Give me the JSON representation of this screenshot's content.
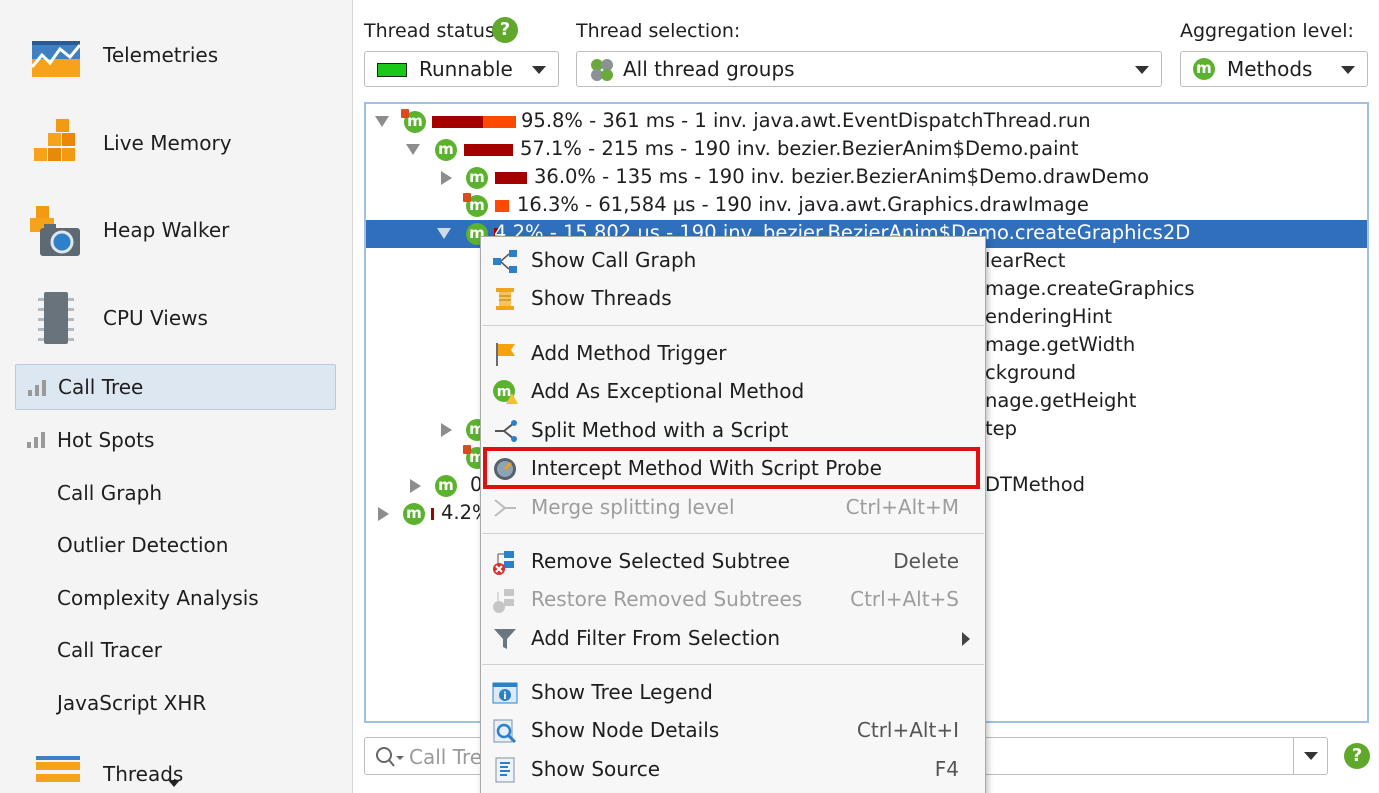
{
  "sidebar": {
    "big_items": [
      {
        "label": "Telemetries",
        "icon": "telemetries-icon"
      },
      {
        "label": "Live Memory",
        "icon": "live-memory-icon"
      },
      {
        "label": "Heap Walker",
        "icon": "heap-walker-icon"
      },
      {
        "label": "CPU Views",
        "icon": "cpu-views-icon"
      }
    ],
    "sub_items": [
      {
        "label": "Call Tree",
        "selected": true
      },
      {
        "label": "Hot Spots"
      },
      {
        "label": "Call Graph"
      },
      {
        "label": "Outlier Detection"
      },
      {
        "label": "Complexity Analysis"
      },
      {
        "label": "Call Tracer"
      },
      {
        "label": "JavaScript XHR"
      }
    ],
    "threads_label": "Threads"
  },
  "toolbar": {
    "thread_status_label": "Thread status:",
    "thread_status_value": "Runnable",
    "thread_status_color": "#19c819",
    "thread_selection_label": "Thread selection:",
    "thread_selection_value": "All thread groups",
    "aggregation_label": "Aggregation level:",
    "aggregation_value": "Methods",
    "aggregation_icon_text": "m",
    "help_icon_text": "?"
  },
  "tree": {
    "rows": [
      {
        "text": "95.8% - 361 ms - 1 inv. java.awt.EventDispatchThread.run",
        "percent": 95.8,
        "expander": "open"
      },
      {
        "text": "57.1% - 215 ms - 190 inv. bezier.BezierAnim$Demo.paint",
        "percent": 57.1,
        "expander": "open"
      },
      {
        "text": "36.0% - 135 ms - 190 inv. bezier.BezierAnim$Demo.drawDemo",
        "percent": 36.0,
        "expander": "closed"
      },
      {
        "text": "16.3% - 61,584 µs - 190 inv. java.awt.Graphics.drawImage",
        "percent": 16.3,
        "expander": "none"
      },
      {
        "text": "4.2% - 15,802 µs - 190 inv. bezier.BezierAnim$Demo.createGraphics2D",
        "percent": 4.2,
        "expander": "open",
        "selected": true
      },
      {
        "text": "learRect"
      },
      {
        "text": "mage.createGraphics"
      },
      {
        "text": "enderingHint"
      },
      {
        "text": "mage.getWidth"
      },
      {
        "text": "ckground"
      },
      {
        "text": "nage.getHeight"
      },
      {
        "text": "tep"
      },
      {
        "text": ""
      },
      {
        "text": "DTMethod"
      },
      {
        "text": "4.2%",
        "percent": 4.2
      }
    ],
    "row_9_prefix": "0"
  },
  "search": {
    "placeholder": "Call Tre"
  },
  "context_menu": {
    "groups": [
      [
        {
          "label": "Show Call Graph",
          "icon": "call-graph-icon"
        },
        {
          "label": "Show Threads",
          "icon": "threads-icon"
        }
      ],
      [
        {
          "label": "Add Method Trigger",
          "icon": "flag-icon"
        },
        {
          "label": "Add As Exceptional Method",
          "icon": "exceptional-method-icon"
        },
        {
          "label": "Split Method with a Script",
          "icon": "split-icon"
        },
        {
          "label": "Intercept Method With Script Probe",
          "icon": "probe-icon",
          "highlighted": true
        },
        {
          "label": "Merge splitting level",
          "shortcut": "Ctrl+Alt+M",
          "icon": "merge-icon",
          "disabled": true
        }
      ],
      [
        {
          "label": "Remove Selected Subtree",
          "shortcut": "Delete",
          "icon": "remove-subtree-icon"
        },
        {
          "label": "Restore Removed Subtrees",
          "shortcut": "Ctrl+Alt+S",
          "icon": "restore-subtrees-icon",
          "disabled": true
        },
        {
          "label": "Add Filter From Selection",
          "icon": "filter-icon",
          "submenu": true
        }
      ],
      [
        {
          "label": "Show Tree Legend",
          "icon": "legend-icon"
        },
        {
          "label": "Show Node Details",
          "shortcut": "Ctrl+Alt+I",
          "icon": "node-details-icon"
        },
        {
          "label": "Show Source",
          "shortcut": "F4",
          "icon": "source-icon"
        }
      ]
    ]
  }
}
